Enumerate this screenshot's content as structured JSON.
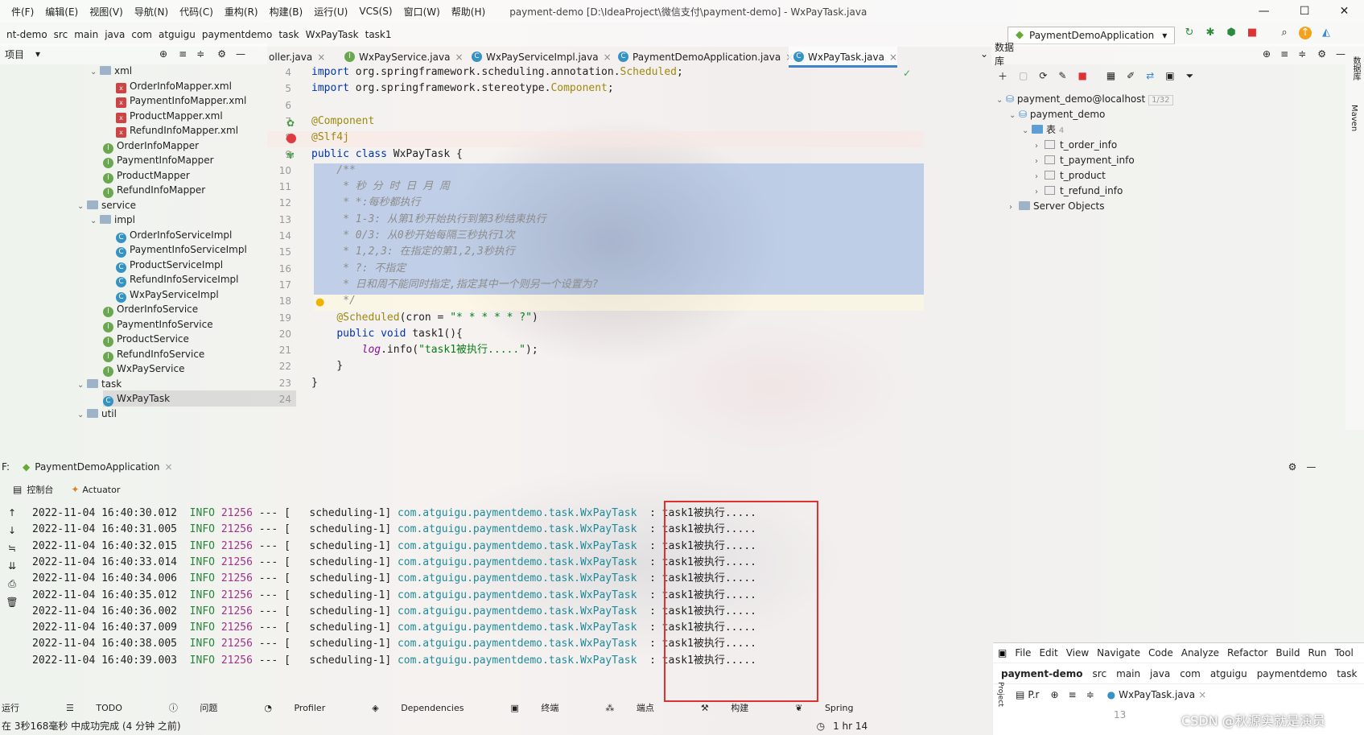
{
  "menu": {
    "items": [
      "件(F)",
      "编辑(E)",
      "视图(V)",
      "导航(N)",
      "代码(C)",
      "重构(R)",
      "构建(B)",
      "运行(U)",
      "VCS(S)",
      "窗口(W)",
      "帮助(H)"
    ],
    "title": "payment-demo [D:\\IdeaProject\\微信支付\\payment-demo] - WxPayTask.java"
  },
  "breadcrumbs": [
    "nt-demo",
    "src",
    "main",
    "java",
    "com",
    "atguigu",
    "paymentdemo",
    "task",
    "WxPayTask",
    "task1"
  ],
  "run_config": "PaymentDemoApplication",
  "project_panel": {
    "title": "项目"
  },
  "tree": [
    {
      "label": "xml",
      "kind": "folder",
      "indent": 1,
      "open": true
    },
    {
      "label": "OrderInfoMapper.xml",
      "kind": "xml",
      "indent": 3
    },
    {
      "label": "PaymentInfoMapper.xml",
      "kind": "xml",
      "indent": 3
    },
    {
      "label": "ProductMapper.xml",
      "kind": "xml",
      "indent": 3
    },
    {
      "label": "RefundInfoMapper.xml",
      "kind": "xml",
      "indent": 3
    },
    {
      "label": "OrderInfoMapper",
      "kind": "i",
      "indent": 2
    },
    {
      "label": "PaymentInfoMapper",
      "kind": "i",
      "indent": 2
    },
    {
      "label": "ProductMapper",
      "kind": "i",
      "indent": 2
    },
    {
      "label": "RefundInfoMapper",
      "kind": "i",
      "indent": 2
    },
    {
      "label": "service",
      "kind": "folder",
      "indent": 0,
      "open": true
    },
    {
      "label": "impl",
      "kind": "folder",
      "indent": 1,
      "open": true
    },
    {
      "label": "OrderInfoServiceImpl",
      "kind": "c",
      "indent": 3
    },
    {
      "label": "PaymentInfoServiceImpl",
      "kind": "c",
      "indent": 3
    },
    {
      "label": "ProductServiceImpl",
      "kind": "c",
      "indent": 3
    },
    {
      "label": "RefundInfoServiceImpl",
      "kind": "c",
      "indent": 3
    },
    {
      "label": "WxPayServiceImpl",
      "kind": "c",
      "indent": 3
    },
    {
      "label": "OrderInfoService",
      "kind": "i",
      "indent": 2
    },
    {
      "label": "PaymentInfoService",
      "kind": "i",
      "indent": 2
    },
    {
      "label": "ProductService",
      "kind": "i",
      "indent": 2
    },
    {
      "label": "RefundInfoService",
      "kind": "i",
      "indent": 2
    },
    {
      "label": "WxPayService",
      "kind": "i",
      "indent": 2
    },
    {
      "label": "task",
      "kind": "folder",
      "indent": 0,
      "open": true
    },
    {
      "label": "WxPayTask",
      "kind": "c",
      "indent": 2,
      "selected": true
    },
    {
      "label": "util",
      "kind": "folder",
      "indent": 0,
      "open": true
    }
  ],
  "editor_tabs": [
    {
      "label": "oller.java",
      "icon": "c",
      "close": "×"
    },
    {
      "label": "WxPayService.java",
      "icon": "i",
      "close": "×"
    },
    {
      "label": "WxPayServiceImpl.java",
      "icon": "c",
      "close": "×"
    },
    {
      "label": "PaymentDemoApplication.java",
      "icon": "c",
      "close": "×"
    },
    {
      "label": "WxPayTask.java",
      "icon": "c",
      "close": "×",
      "active": true
    }
  ],
  "line_numbers": [
    "4",
    "5",
    "6",
    "7",
    "8",
    "9",
    "10",
    "11",
    "12",
    "13",
    "14",
    "15",
    "16",
    "17",
    "18",
    "19",
    "20",
    "21",
    "22",
    "23",
    "24"
  ],
  "code_lines": [
    [
      [
        "import ",
        "kw"
      ],
      [
        "org.springframework.scheduling.annotation.",
        "pl"
      ],
      [
        "Scheduled",
        "ann"
      ],
      [
        ";",
        "pl"
      ]
    ],
    [
      [
        "import ",
        "kw"
      ],
      [
        "org.springframework.stereotype.",
        "pl"
      ],
      [
        "Component",
        "ann"
      ],
      [
        ";",
        "pl"
      ]
    ],
    [],
    [
      [
        "@Component",
        "ann"
      ]
    ],
    [
      [
        "@Slf4j",
        "ann"
      ]
    ],
    [
      [
        "public class ",
        "kw"
      ],
      [
        "WxPayTask {",
        "pl"
      ]
    ],
    [
      [
        "    /**",
        "cmt"
      ]
    ],
    [
      [
        "     * 秒 分 时 日 月 周",
        "cmt"
      ]
    ],
    [
      [
        "     * *:每秒都执行",
        "cmt"
      ]
    ],
    [
      [
        "     * 1-3: 从第1秒开始执行到第3秒结束执行",
        "cmt"
      ]
    ],
    [
      [
        "     * 0/3: 从0秒开始每隔三秒执行1次",
        "cmt"
      ]
    ],
    [
      [
        "     * 1,2,3: 在指定的第1,2,3秒执行",
        "cmt"
      ]
    ],
    [
      [
        "     * ?: 不指定",
        "cmt"
      ]
    ],
    [
      [
        "     * 日和周不能同时指定,指定其中一个则另一个设置为?",
        "cmt"
      ]
    ],
    [
      [
        "     */",
        "cmt"
      ]
    ],
    [
      [
        "    ",
        "pl"
      ],
      [
        "@Scheduled",
        "ann"
      ],
      [
        "(cron = ",
        "pl"
      ],
      [
        "\"* * * * * ?\"",
        "str"
      ],
      [
        ")",
        "pl"
      ]
    ],
    [
      [
        "    ",
        "pl"
      ],
      [
        "public void ",
        "kw"
      ],
      [
        "task1(){",
        "pl"
      ]
    ],
    [
      [
        "        ",
        "pl"
      ],
      [
        "log",
        "fld"
      ],
      [
        ".info(",
        "pl"
      ],
      [
        "\"task1被执行.....\"",
        "str"
      ],
      [
        ");",
        "pl"
      ]
    ],
    [
      [
        "    }",
        "pl"
      ]
    ],
    [
      [
        "}",
        "pl"
      ]
    ],
    []
  ],
  "db_panel": {
    "title": "数据库",
    "connection": "payment_demo@localhost",
    "connection_count": "1/32",
    "schema": "payment_demo",
    "tables_label": "表",
    "tables_count": "4",
    "tables": [
      "t_order_info",
      "t_payment_info",
      "t_product",
      "t_refund_info"
    ],
    "server_objects": "Server Objects"
  },
  "run_panel": {
    "title": "PaymentDemoApplication",
    "tabs": [
      "控制台",
      "Actuator"
    ]
  },
  "log": [
    {
      "time": "2022-11-04 16:40:30.012",
      "level": "INFO",
      "pid": "21256",
      "sep": "---",
      "thread": "[   scheduling-1]",
      "logger": "com.atguigu.paymentdemo.task.WxPayTask",
      "msg": ": task1被执行....."
    },
    {
      "time": "2022-11-04 16:40:31.005",
      "level": "INFO",
      "pid": "21256",
      "sep": "---",
      "thread": "[   scheduling-1]",
      "logger": "com.atguigu.paymentdemo.task.WxPayTask",
      "msg": ": task1被执行....."
    },
    {
      "time": "2022-11-04 16:40:32.015",
      "level": "INFO",
      "pid": "21256",
      "sep": "---",
      "thread": "[   scheduling-1]",
      "logger": "com.atguigu.paymentdemo.task.WxPayTask",
      "msg": ": task1被执行....."
    },
    {
      "time": "2022-11-04 16:40:33.014",
      "level": "INFO",
      "pid": "21256",
      "sep": "---",
      "thread": "[   scheduling-1]",
      "logger": "com.atguigu.paymentdemo.task.WxPayTask",
      "msg": ": task1被执行....."
    },
    {
      "time": "2022-11-04 16:40:34.006",
      "level": "INFO",
      "pid": "21256",
      "sep": "---",
      "thread": "[   scheduling-1]",
      "logger": "com.atguigu.paymentdemo.task.WxPayTask",
      "msg": ": task1被执行....."
    },
    {
      "time": "2022-11-04 16:40:35.012",
      "level": "INFO",
      "pid": "21256",
      "sep": "---",
      "thread": "[   scheduling-1]",
      "logger": "com.atguigu.paymentdemo.task.WxPayTask",
      "msg": ": task1被执行....."
    },
    {
      "time": "2022-11-04 16:40:36.002",
      "level": "INFO",
      "pid": "21256",
      "sep": "---",
      "thread": "[   scheduling-1]",
      "logger": "com.atguigu.paymentdemo.task.WxPayTask",
      "msg": ": task1被执行....."
    },
    {
      "time": "2022-11-04 16:40:37.009",
      "level": "INFO",
      "pid": "21256",
      "sep": "---",
      "thread": "[   scheduling-1]",
      "logger": "com.atguigu.paymentdemo.task.WxPayTask",
      "msg": ": task1被执行....."
    },
    {
      "time": "2022-11-04 16:40:38.005",
      "level": "INFO",
      "pid": "21256",
      "sep": "---",
      "thread": "[   scheduling-1]",
      "logger": "com.atguigu.paymentdemo.task.WxPayTask",
      "msg": ": task1被执行....."
    },
    {
      "time": "2022-11-04 16:40:39.003",
      "level": "INFO",
      "pid": "21256",
      "sep": "---",
      "thread": "[   scheduling-1]",
      "logger": "com.atguigu.paymentdemo.task.WxPayTask",
      "msg": ": task1被执行....."
    }
  ],
  "bottom_tools": [
    "运行",
    "TODO",
    "问题",
    "Profiler",
    "Dependencies",
    "终端",
    "端点",
    "构建",
    "Spring"
  ],
  "status": {
    "message": "在 3秒168毫秒 中成功完成 (4 分钟 之前)",
    "position": "1 hr 14"
  },
  "mini_ide": {
    "menu": [
      "File",
      "Edit",
      "View",
      "Navigate",
      "Code",
      "Analyze",
      "Refactor",
      "Build",
      "Run",
      "Tool"
    ],
    "crumbs": [
      "payment-demo",
      "src",
      "main",
      "java",
      "com",
      "atguigu",
      "paymentdemo",
      "task"
    ],
    "project_tab": "P.r",
    "file_tab": "WxPayTask.java",
    "line": "13",
    "side_label": "Project"
  },
  "right_strip": [
    "数据库",
    "Maven"
  ],
  "watermark": "CSDN @秋源实就是演员",
  "colors": {
    "highlight_box": "#e03030",
    "selection": "#a9c6ef",
    "breakpoint": "#e0393e"
  }
}
